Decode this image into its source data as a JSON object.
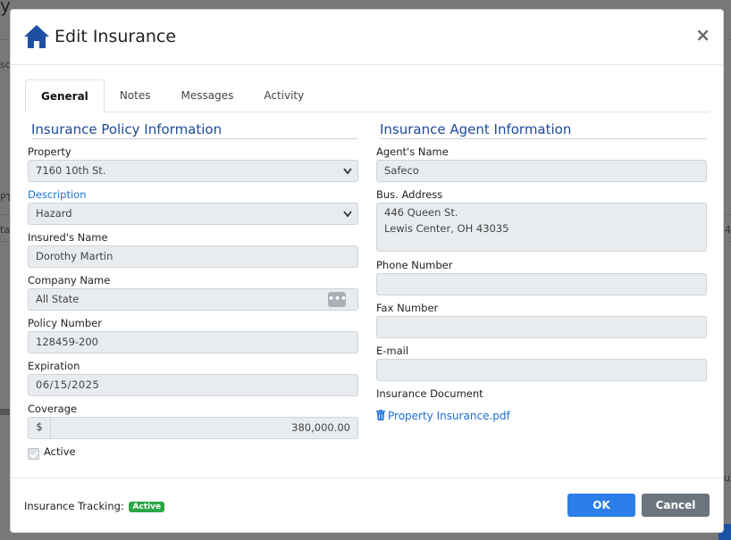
{
  "modal": {
    "title": "Edit Insurance",
    "close": "×"
  },
  "tabs": [
    "General",
    "Notes",
    "Messages",
    "Activity"
  ],
  "policy": {
    "section_title": "Insurance Policy Information",
    "property_label": "Property",
    "property_value": "7160 10th St.",
    "description_label": "Description",
    "description_value": "Hazard",
    "insured_label": "Insured's Name",
    "insured_value": "Dorothy Martin",
    "company_label": "Company Name",
    "company_value": "All State",
    "company_button": "•••",
    "policy_number_label": "Policy Number",
    "policy_number_value": "128459-200",
    "expiration_label": "Expiration",
    "expiration_value": "06/15/2025",
    "coverage_label": "Coverage",
    "coverage_currency": "$",
    "coverage_value": "380,000.00",
    "active_label": "Active"
  },
  "agent": {
    "section_title": "Insurance Agent Information",
    "name_label": "Agent's Name",
    "name_value": "Safeco",
    "address_label": "Bus. Address",
    "address_line1": "446 Queen St.",
    "address_line2": "Lewis Center, OH 43035",
    "phone_label": "Phone Number",
    "phone_value": "",
    "fax_label": "Fax Number",
    "fax_value": "",
    "email_label": "E-mail",
    "email_value": "",
    "document_label": "Insurance Document",
    "document_link": "Property Insurance.pdf"
  },
  "footer": {
    "tracking_label": "Insurance Tracking:",
    "tracking_badge": "Active",
    "ok_label": "OK",
    "cancel_label": "Cancel"
  },
  "background": {
    "title_fragment": "y",
    "text1": "sc",
    "text2": "PT",
    "text3": "ta",
    "text4": "4",
    "text5": "us"
  },
  "colors": {
    "accent": "#2c7ee8",
    "section_title": "#1d4b9b",
    "badge": "#28a745",
    "cancel": "#6c757d"
  },
  "icons": [
    "home-icon",
    "close-icon",
    "chevron-down-icon",
    "ellipsis-icon",
    "trash-icon",
    "checkmark-icon"
  ]
}
